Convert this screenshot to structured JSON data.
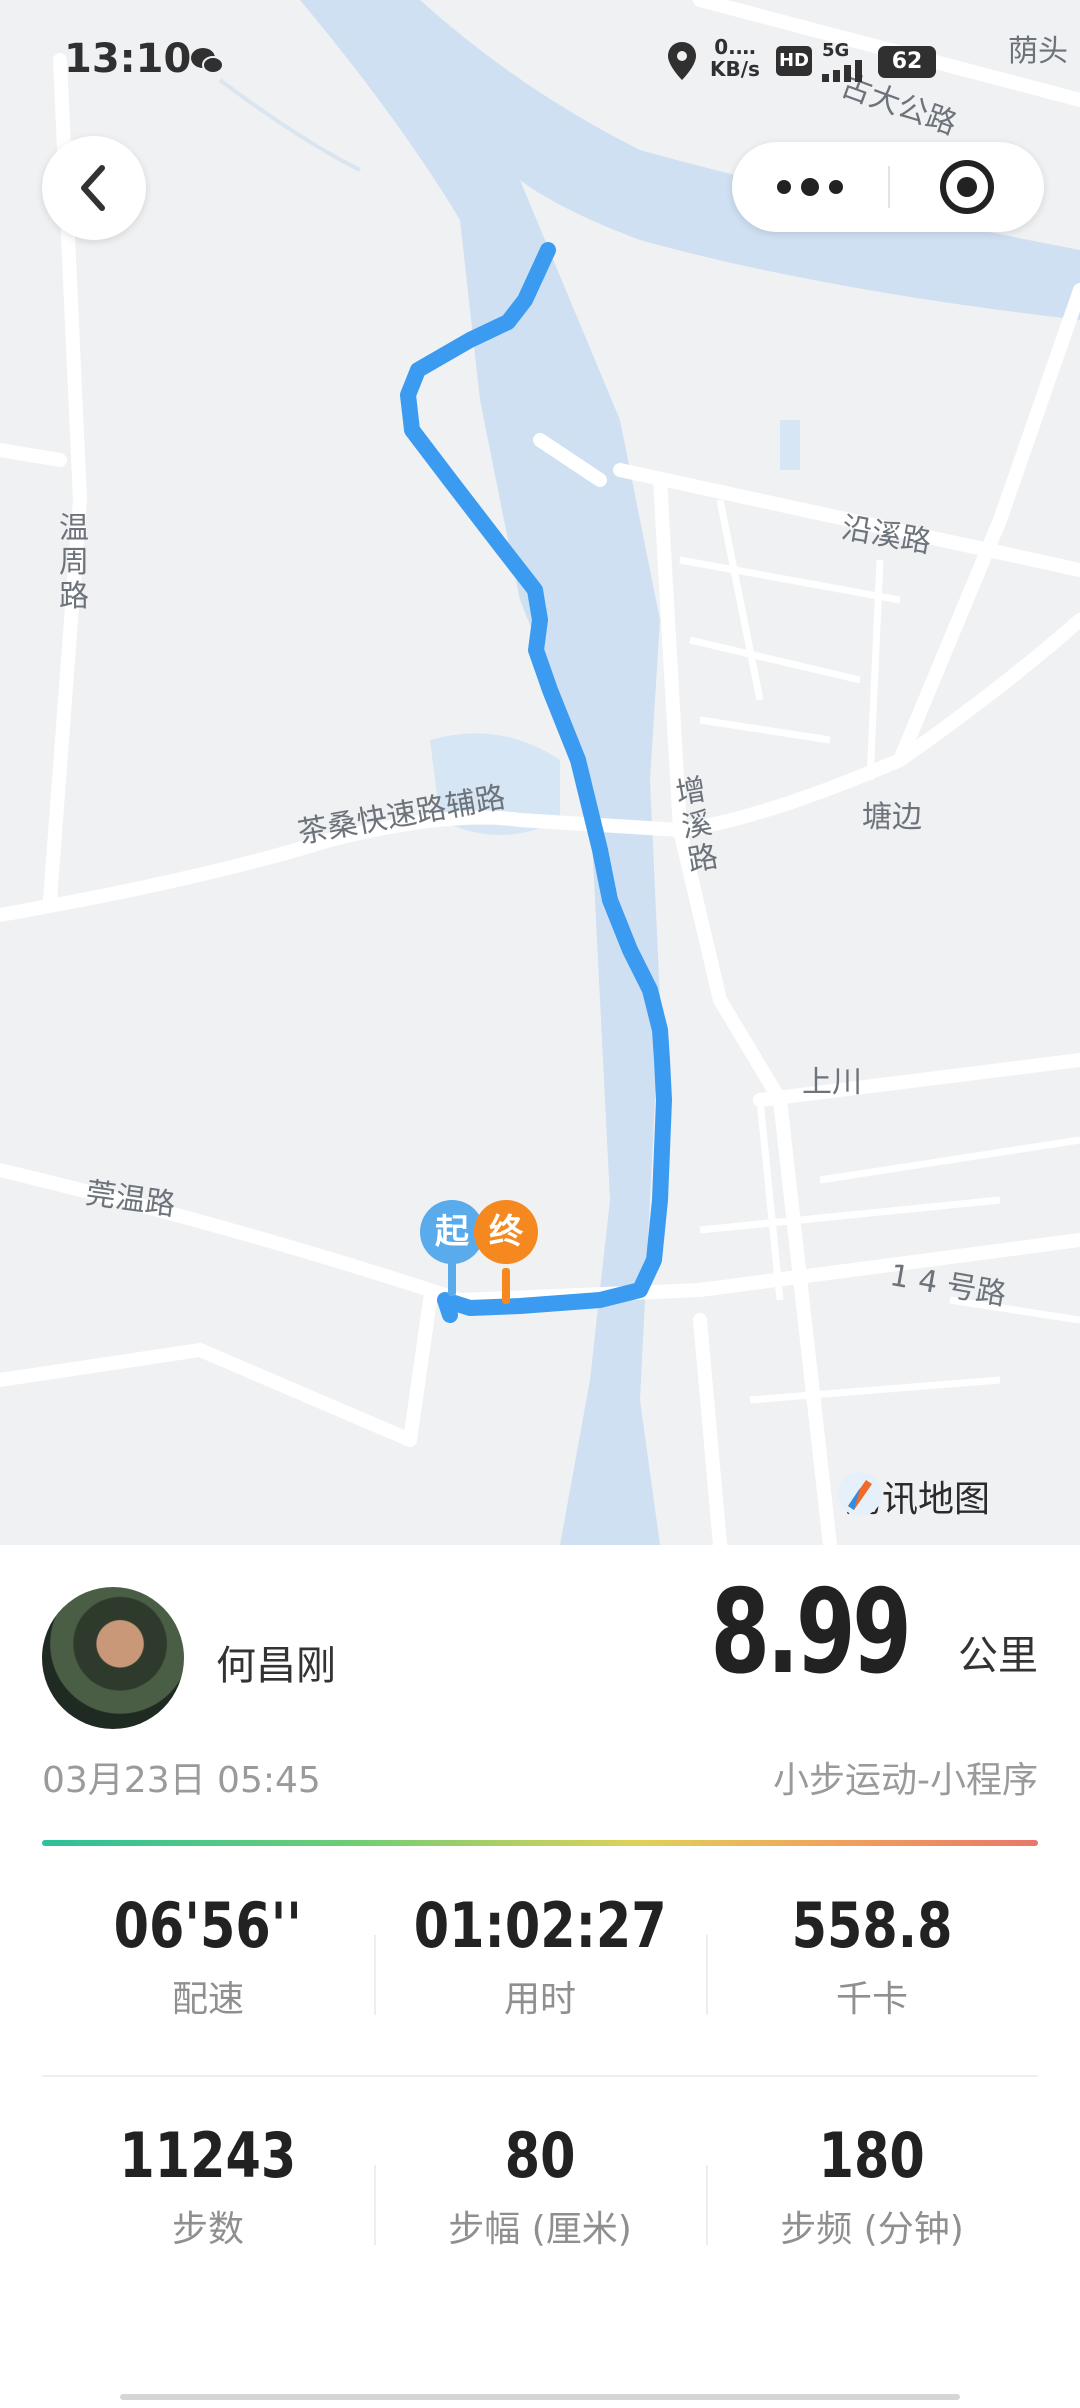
{
  "status_bar": {
    "time": "13:10",
    "net_speed_top": "0.…",
    "net_speed_unit": "KB/s",
    "hd": "HD",
    "signal": "5G",
    "battery": "62"
  },
  "map": {
    "labels": {
      "top_right": "荫头",
      "gudagong_road": "古大公路",
      "wenzhou_road": "温周路",
      "yanxi_road": "沿溪路",
      "chasang_road": "茶桑快速路辅路",
      "zengxi_road": "增溪路",
      "tangbian": "塘边",
      "shangchuan": "上川",
      "guanwen_road": "莞温路",
      "road_14": "1 4 号路"
    },
    "start_pin": "起",
    "end_pin": "终",
    "provider": "腾讯地图",
    "colors": {
      "route": "#3a9bf0",
      "start": "#5aabec",
      "end": "#f5891f",
      "water": "#cfe0f2"
    }
  },
  "summary": {
    "name": "何昌刚",
    "distance": "8.99",
    "distance_unit": "公里",
    "datetime": "03月23日 05:45",
    "source": "小步运动-小程序"
  },
  "stats": [
    {
      "value": "06'56''",
      "label": "配速"
    },
    {
      "value": "01:02:27",
      "label": "用时"
    },
    {
      "value": "558.8",
      "label": "千卡"
    },
    {
      "value": "11243",
      "label": "步数"
    },
    {
      "value": "80",
      "label": "步幅 (厘米)"
    },
    {
      "value": "180",
      "label": "步频 (分钟)"
    }
  ]
}
